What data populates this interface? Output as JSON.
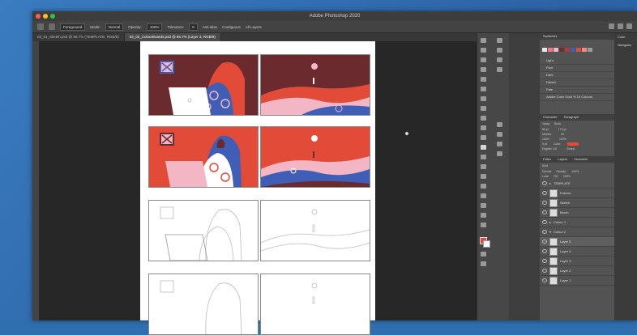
{
  "app": {
    "title": "Adobe Photoshop 2020"
  },
  "options": {
    "mode_label": "Mode:",
    "mode_value": "Normal",
    "opacity_label": "Opacity:",
    "opacity_value": "100%",
    "tolerance_label": "Tolerance:",
    "tolerance_value": "0",
    "antialias": "Anti-alias",
    "contiguous": "Contiguous",
    "all_layers": "All Layers",
    "fill_value": "Foreground"
  },
  "tabs": [
    {
      "label": "03_01_Sketch.psd @ 66.7% (TEMPLATE, RGB/8)"
    },
    {
      "label": "03_02_ColourBoards.psd @ 66.7% (Layer 3, RGB/8)"
    }
  ],
  "swatches": {
    "title": "Swatches",
    "folders": [
      "Light",
      "Pure",
      "Dark",
      "Darker",
      "Pale",
      "Adobe Color Gold Yt 10 Colours"
    ],
    "colors": [
      "#e8e8e8",
      "#f07a86",
      "#f2b6c4",
      "#6a2f2f",
      "#b03a3a",
      "#3f5fb7",
      "#e14b37",
      "#f28b7f",
      "#9a9a9a"
    ]
  },
  "character": {
    "title": "Character",
    "tab2": "Paragraph",
    "font": "Varag",
    "style": "Book",
    "size": "80 pt",
    "leading": "170 pt",
    "metrics": "Metrics",
    "tracking": "50",
    "scale_v": "100%",
    "scale_h": "100%",
    "baseline": "0 pt",
    "color_label": "Color:",
    "language": "English: UK",
    "aa": "Sharp",
    "color": "#e14b37"
  },
  "layers": {
    "tabs": [
      "Paths",
      "Layers",
      "Channels"
    ],
    "kind": "Kind",
    "blend": "Normal",
    "opacity_label": "Opacity:",
    "opacity": "100%",
    "lock_label": "Lock:",
    "fill_label": "Fill:",
    "fill": "100%",
    "items": [
      {
        "name": "TEMPLATE",
        "type": "group"
      },
      {
        "name": "Frames",
        "type": "layer"
      },
      {
        "name": "Sketch",
        "type": "layer"
      },
      {
        "name": "Brush",
        "type": "layer"
      },
      {
        "name": "Colour 1",
        "type": "group"
      },
      {
        "name": "Colour 2",
        "type": "group"
      },
      {
        "name": "Layer 5",
        "type": "layer",
        "selected": true
      },
      {
        "name": "Layer 4",
        "type": "layer"
      },
      {
        "name": "Layer 3",
        "type": "layer"
      },
      {
        "name": "Layer 2",
        "type": "layer"
      },
      {
        "name": "Layer 1",
        "type": "layer"
      }
    ]
  },
  "right_panel": {
    "color": "Color",
    "navigator": "Navigator"
  }
}
